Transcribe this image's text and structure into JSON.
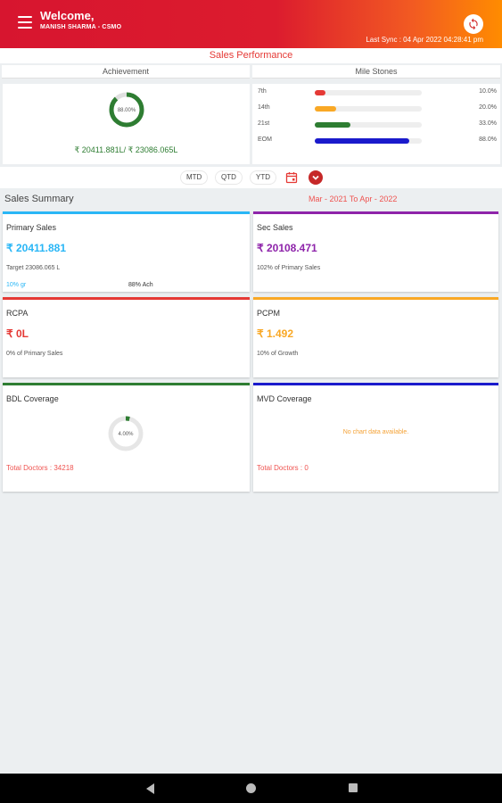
{
  "header": {
    "welcome": "Welcome,",
    "user": "MANISH SHARMA - CSMO",
    "last_sync": "Last Sync : 04 Apr 2022 04:28:41 pm"
  },
  "page_title": "Sales Performance",
  "achievement": {
    "heading": "Achievement",
    "percent": "88.00%",
    "fraction": 0.88,
    "amount_text": "₹ 20411.881L/ ₹ 23086.065L"
  },
  "milestones": {
    "heading": "Mile Stones",
    "items": [
      {
        "label": "7th",
        "percent": "10.0%",
        "value": 10,
        "color": "#e53935"
      },
      {
        "label": "14th",
        "percent": "20.0%",
        "value": 20,
        "color": "#f9a825"
      },
      {
        "label": "21st",
        "percent": "33.0%",
        "value": 33,
        "color": "#2e7d32"
      },
      {
        "label": "EOM",
        "percent": "88.0%",
        "value": 88,
        "color": "#1a1acc"
      }
    ]
  },
  "filters": {
    "mtd": "MTD",
    "qtd": "QTD",
    "ytd": "YTD"
  },
  "summary": {
    "title": "Sales Summary",
    "range": "Mar - 2021 To Apr - 2022"
  },
  "cards": {
    "primary": {
      "title": "Primary Sales",
      "value": "₹ 20411.881",
      "target": "Target 23086.065 L",
      "growth": "10% gr",
      "ach": "88% Ach",
      "color": "#29b6f6"
    },
    "sec": {
      "title": "Sec Sales",
      "value": "₹ 20108.471",
      "sub": "102% of Primary Sales",
      "color": "#8e24aa"
    },
    "rcpa": {
      "title": "RCPA",
      "value": "₹ 0L",
      "sub": "0% of Primary Sales",
      "color": "#e53935"
    },
    "pcpm": {
      "title": "PCPM",
      "value": "₹ 1.492",
      "sub": "10% of Growth",
      "color": "#f9a825"
    },
    "bdl": {
      "title": "BDL Coverage",
      "percent": "4.00%",
      "fraction": 0.04,
      "total": "Total Doctors : 34218",
      "color": "#2e7d32"
    },
    "mvd": {
      "title": "MVD Coverage",
      "no_data": "No chart data available.",
      "total": "Total Doctors : 0",
      "color": "#1a1acc"
    }
  },
  "icons": {
    "menu": "hamburger-menu-icon",
    "sync": "sync-refresh-icon",
    "calendar": "calendar-icon",
    "chevron": "chevron-down-icon"
  }
}
